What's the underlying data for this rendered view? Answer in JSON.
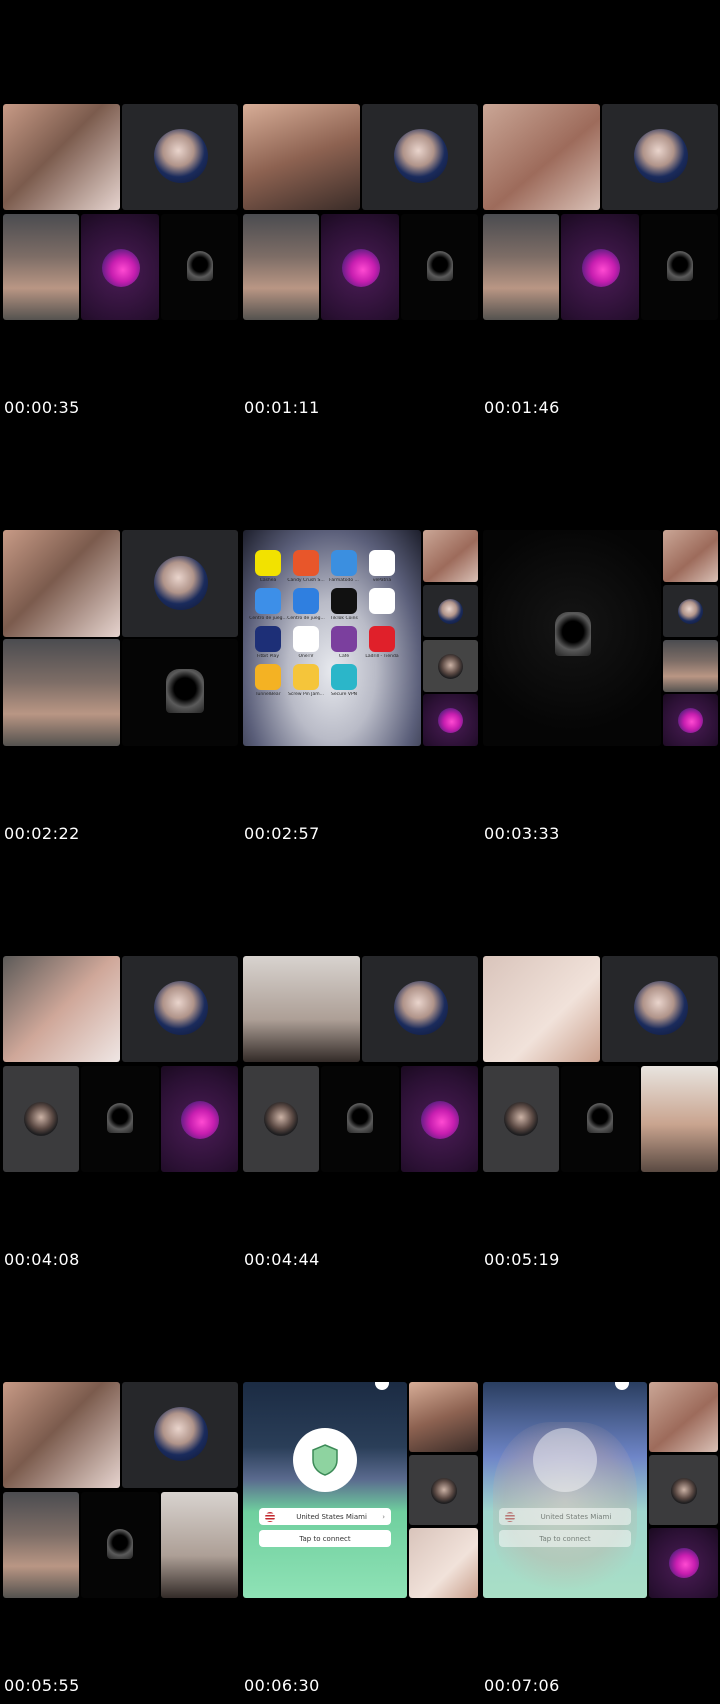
{
  "thumbnails": [
    {
      "timestamp": "00:00:35"
    },
    {
      "timestamp": "00:01:11"
    },
    {
      "timestamp": "00:01:46"
    },
    {
      "timestamp": "00:02:22"
    },
    {
      "timestamp": "00:02:57"
    },
    {
      "timestamp": "00:03:33"
    },
    {
      "timestamp": "00:04:08"
    },
    {
      "timestamp": "00:04:44"
    },
    {
      "timestamp": "00:05:19"
    },
    {
      "timestamp": "00:05:55"
    },
    {
      "timestamp": "00:06:30"
    },
    {
      "timestamp": "00:07:06"
    }
  ],
  "home_screen": {
    "apps": [
      {
        "label": "Cashea",
        "color": "#f2e200"
      },
      {
        "label": "Candy Crush S...",
        "color": "#e8562a"
      },
      {
        "label": "Farmatodo ...",
        "color": "#3b8fe0"
      },
      {
        "label": "vePatria",
        "color": "#ffffff"
      },
      {
        "label": "Centro de jueg...",
        "color": "#3d8fe8"
      },
      {
        "label": "Centro de jueg...",
        "color": "#2f7fe0"
      },
      {
        "label": "TikTok Coins",
        "color": "#111111"
      },
      {
        "label": "",
        "color": "#ffffff"
      },
      {
        "label": "Fitbit Play",
        "color": "#1d2f77"
      },
      {
        "label": "OneTV",
        "color": "#ffffff"
      },
      {
        "label": "Café",
        "color": "#7b3f9e"
      },
      {
        "label": "Ladrill - Tienda",
        "color": "#e0202a"
      },
      {
        "label": "TunnelBear",
        "color": "#f4b223"
      },
      {
        "label": "Screw Pin Jam...",
        "color": "#f5c53a"
      },
      {
        "label": "Secure VPN",
        "color": "#2bb6c9"
      }
    ],
    "cafe_icon_text": "Café",
    "tiktok_icon_text": "TikTok"
  },
  "vpn": {
    "location": "United States Miami",
    "connect_label": "Tap to connect",
    "chevron": "›"
  },
  "colors": {
    "background": "#000000",
    "tile_dark": "#26272a",
    "vpn_green": "#6fcf9e"
  }
}
